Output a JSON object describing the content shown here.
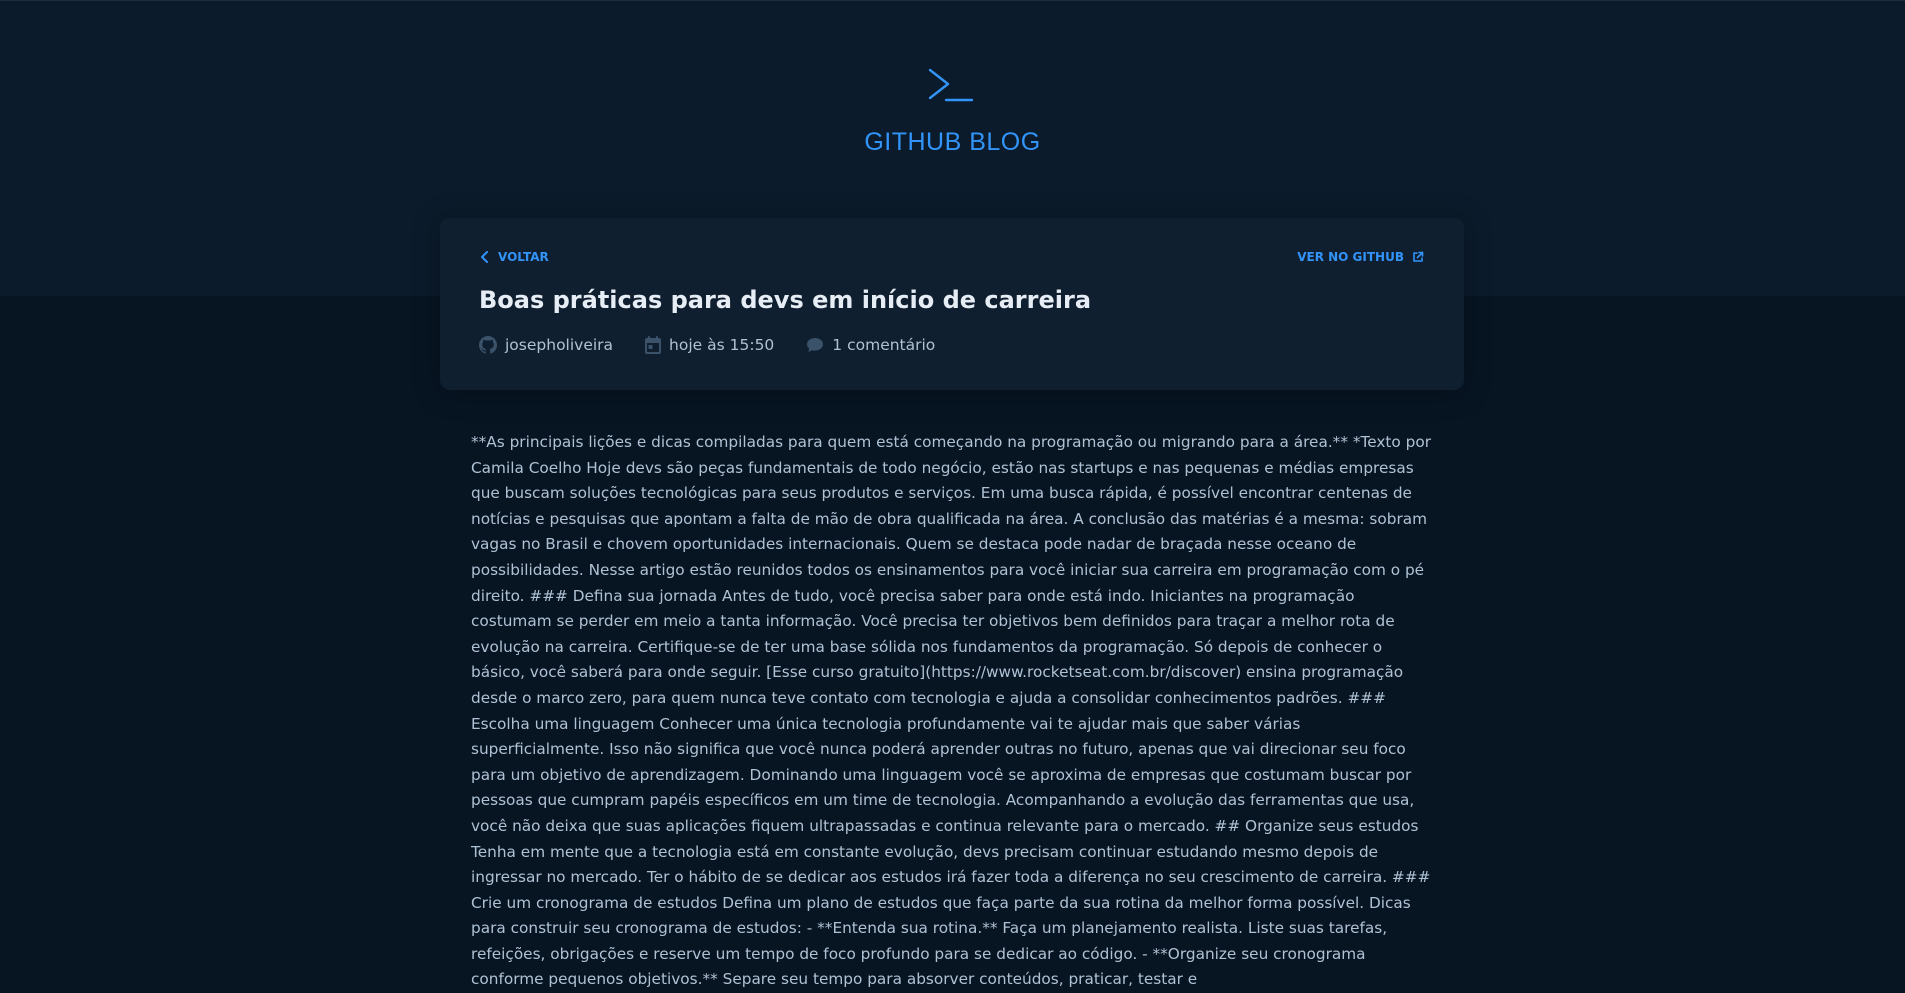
{
  "header": {
    "brand": "GITHUB BLOG",
    "logo_icon": "terminal-icon"
  },
  "post": {
    "back_label": "VOLTAR",
    "github_label": "VER NO GITHUB",
    "title": "Boas práticas para devs em início de carreira",
    "author": "josepholiveira",
    "date": "hoje às 15:50",
    "comments": "1 comentário",
    "body": "**As principais lições e dicas compiladas para quem está começando na programação ou migrando para a área.** *Texto por Camila Coelho Hoje devs são peças fundamentais de todo negócio, estão nas startups e nas pequenas e médias empresas que buscam soluções tecnológicas para seus produtos e serviços. Em uma busca rápida, é possível encontrar centenas de notícias e pesquisas que apontam a falta de mão de obra qualificada na área. A conclusão das matérias é a mesma: sobram vagas no Brasil e chovem oportunidades internacionais. Quem se destaca pode nadar de braçada nesse oceano de possibilidades. Nesse artigo estão reunidos todos os ensinamentos para você iniciar sua carreira em programação com o pé direito. ### Defina sua jornada Antes de tudo, você precisa saber para onde está indo. Iniciantes na programação costumam se perder em meio a tanta informação. Você precisa ter objetivos bem definidos para traçar a melhor rota de evolução na carreira. Certifique-se de ter uma base sólida nos fundamentos da programação. Só depois de conhecer o básico, você saberá para onde seguir. [Esse curso gratuito](https://www.rocketseat.com.br/discover) ensina programação desde o marco zero, para quem nunca teve contato com tecnologia e ajuda a consolidar conhecimentos padrões. ### Escolha uma linguagem Conhecer uma única tecnologia profundamente vai te ajudar mais que saber várias superficialmente. Isso não significa que você nunca poderá aprender outras no futuro, apenas que vai direcionar seu foco para um objetivo de aprendizagem. Dominando uma linguagem você se aproxima de empresas que costumam buscar por pessoas que cumpram papéis específicos em um time de tecnologia. Acompanhando a evolução das ferramentas que usa, você não deixa que suas aplicações fiquem ultrapassadas e continua relevante para o mercado. ## Organize seus estudos Tenha em mente que a tecnologia está em constante evolução, devs precisam continuar estudando mesmo depois de ingressar no mercado. Ter o hábito de se dedicar aos estudos irá fazer toda a diferença no seu crescimento de carreira. ### Crie um cronograma de estudos Defina um plano de estudos que faça parte da sua rotina da melhor forma possível. Dicas para construir seu cronograma de estudos: - **Entenda sua rotina.** Faça um planejamento realista. Liste suas tarefas, refeições, obrigações e reserve um tempo de foco profundo para se dedicar ao código. - **Organize seu cronograma conforme pequenos objetivos.** Separe seu tempo para absorver conteúdos, praticar, testar e"
  },
  "colors": {
    "accent": "#3294f8",
    "header_bg": "#0b1b2b",
    "page_bg": "#071422",
    "card_bg": "#0f1f30",
    "title": "#e7edf4",
    "text": "#afc2d4",
    "meta_icon": "#3a536b"
  },
  "icons": {
    "back": "chevron-left-icon",
    "external": "external-link-icon",
    "author": "github-icon",
    "date": "calendar-icon",
    "comments": "comment-icon"
  }
}
